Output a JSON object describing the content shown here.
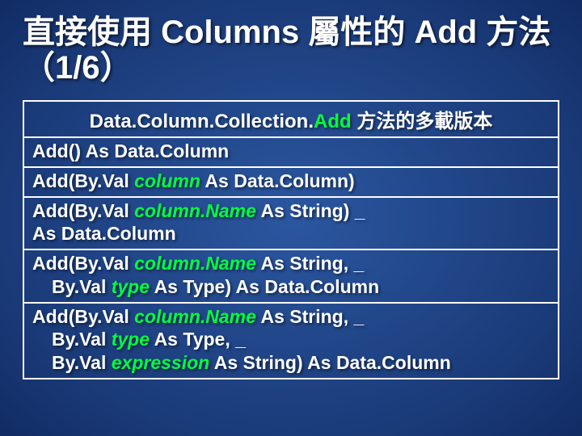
{
  "title": "直接使用 Columns 屬性的 Add 方法（1/6）",
  "header": {
    "dcc": "Data.Column.Collection.",
    "add": "Add",
    "suffix": " 方法的多載版本"
  },
  "rows": {
    "r0": "Add() As Data.Column",
    "r1": {
      "p0": "Add(By.Val ",
      "param0": "column",
      "p1": " As Data.Column)"
    },
    "r2": {
      "p0": "Add(By.Val ",
      "param0": "column.Name",
      "p1": " As String) _",
      "p2": " As Data.Column"
    },
    "r3": {
      "p0": "Add(By.Val ",
      "param0": "column.Name",
      "p1": " As String, _",
      "c1a": "By.Val ",
      "param1": "type",
      "c1b": " As Type) As Data.Column"
    },
    "r4": {
      "p0": "Add(By.Val ",
      "param0": "column.Name",
      "p1": " As String, _",
      "c1a": "By.Val ",
      "param1": "type",
      "c1b": " As Type, _",
      "c2a": "By.Val ",
      "param2": "expression",
      "c2b": " As String) As Data.Column"
    }
  }
}
